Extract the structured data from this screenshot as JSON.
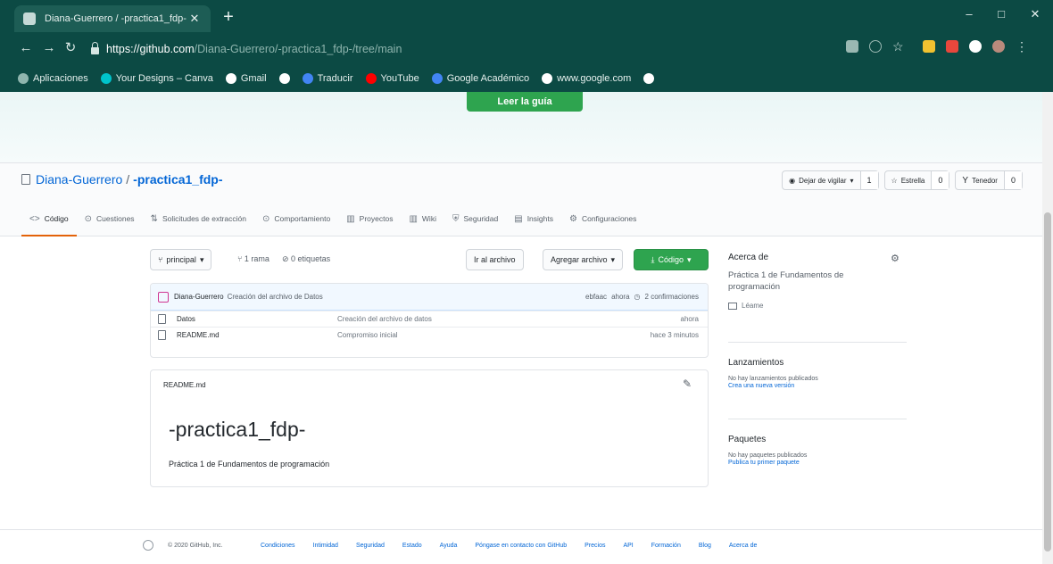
{
  "browser": {
    "tab_title": "Diana-Guerrero / -practica1_fdp-",
    "new_tab": "+",
    "window": {
      "minimize": "–",
      "maximize": "□",
      "close": "✕"
    },
    "url_host": "https://github.com",
    "url_path": "/Diana-Guerrero/-practica1_fdp-/tree/main",
    "bookmarks": [
      {
        "label": "Aplicaciones",
        "color": "#8fb5ae"
      },
      {
        "label": "Your Designs – Canva",
        "color": "#00c4cc"
      },
      {
        "label": "Gmail",
        "color": "#ffffff"
      },
      {
        "label": "",
        "color": "#ffffff"
      },
      {
        "label": "Traducir",
        "color": "#4285f4"
      },
      {
        "label": "YouTube",
        "color": "#ff0000"
      },
      {
        "label": "Google Académico",
        "color": "#4285f4"
      },
      {
        "label": "www.google.com",
        "color": "#ffffff"
      },
      {
        "label": "",
        "color": "#ffffff"
      }
    ]
  },
  "banner": {
    "guide_button": "Leer la guía"
  },
  "repo": {
    "owner": "Diana-Guerrero",
    "separator": "/",
    "name": "-practica1_fdp-",
    "watch": {
      "label": "Dejar de vigilar",
      "count": "1"
    },
    "star": {
      "label": "Estrella",
      "count": "0"
    },
    "fork": {
      "label": "Tenedor",
      "count": "0"
    },
    "tabs": [
      "Código",
      "Cuestiones",
      "Solicitudes de extracción",
      "Comportamiento",
      "Proyectos",
      "Wiki",
      "Seguridad",
      "Insights",
      "Configuraciones"
    ]
  },
  "filebar": {
    "branch": "principal",
    "branches": "1 rama",
    "tags": "0 etiquetas",
    "goto_file": "Ir al archivo",
    "add_file": "Agregar archivo",
    "code": "Código"
  },
  "commit": {
    "author": "Diana-Guerrero",
    "message": "Creación del archivo de Datos",
    "hash": "ebfaac",
    "age": "ahora",
    "commits": "2 confirmaciones"
  },
  "files": [
    {
      "name": "Datos",
      "message": "Creación del archivo de datos",
      "age": "ahora"
    },
    {
      "name": "README.md",
      "message": "Compromiso inicial",
      "age": "hace 3 minutos"
    }
  ],
  "readme": {
    "filename": "README.md",
    "heading": "-practica1_fdp-",
    "text": "Práctica 1 de Fundamentos de programación"
  },
  "sidebar": {
    "about_title": "Acerca de",
    "description": "Práctica 1 de Fundamentos de programación",
    "license": "Léame",
    "releases_title": "Lanzamientos",
    "releases_note": "No hay lanzamientos publicados",
    "releases_link": "Crea una nueva versión",
    "packages_title": "Paquetes",
    "packages_note": "No hay paquetes publicados",
    "packages_link": "Publica tu primer paquete"
  },
  "footer": {
    "copyright": "© 2020 GitHub, Inc.",
    "links": [
      "Condiciones",
      "Intimidad",
      "Seguridad",
      "Estado",
      "Ayuda",
      "Póngase en contacto con GitHub",
      "Precios",
      "API",
      "Formación",
      "Blog",
      "Acerca de"
    ]
  }
}
